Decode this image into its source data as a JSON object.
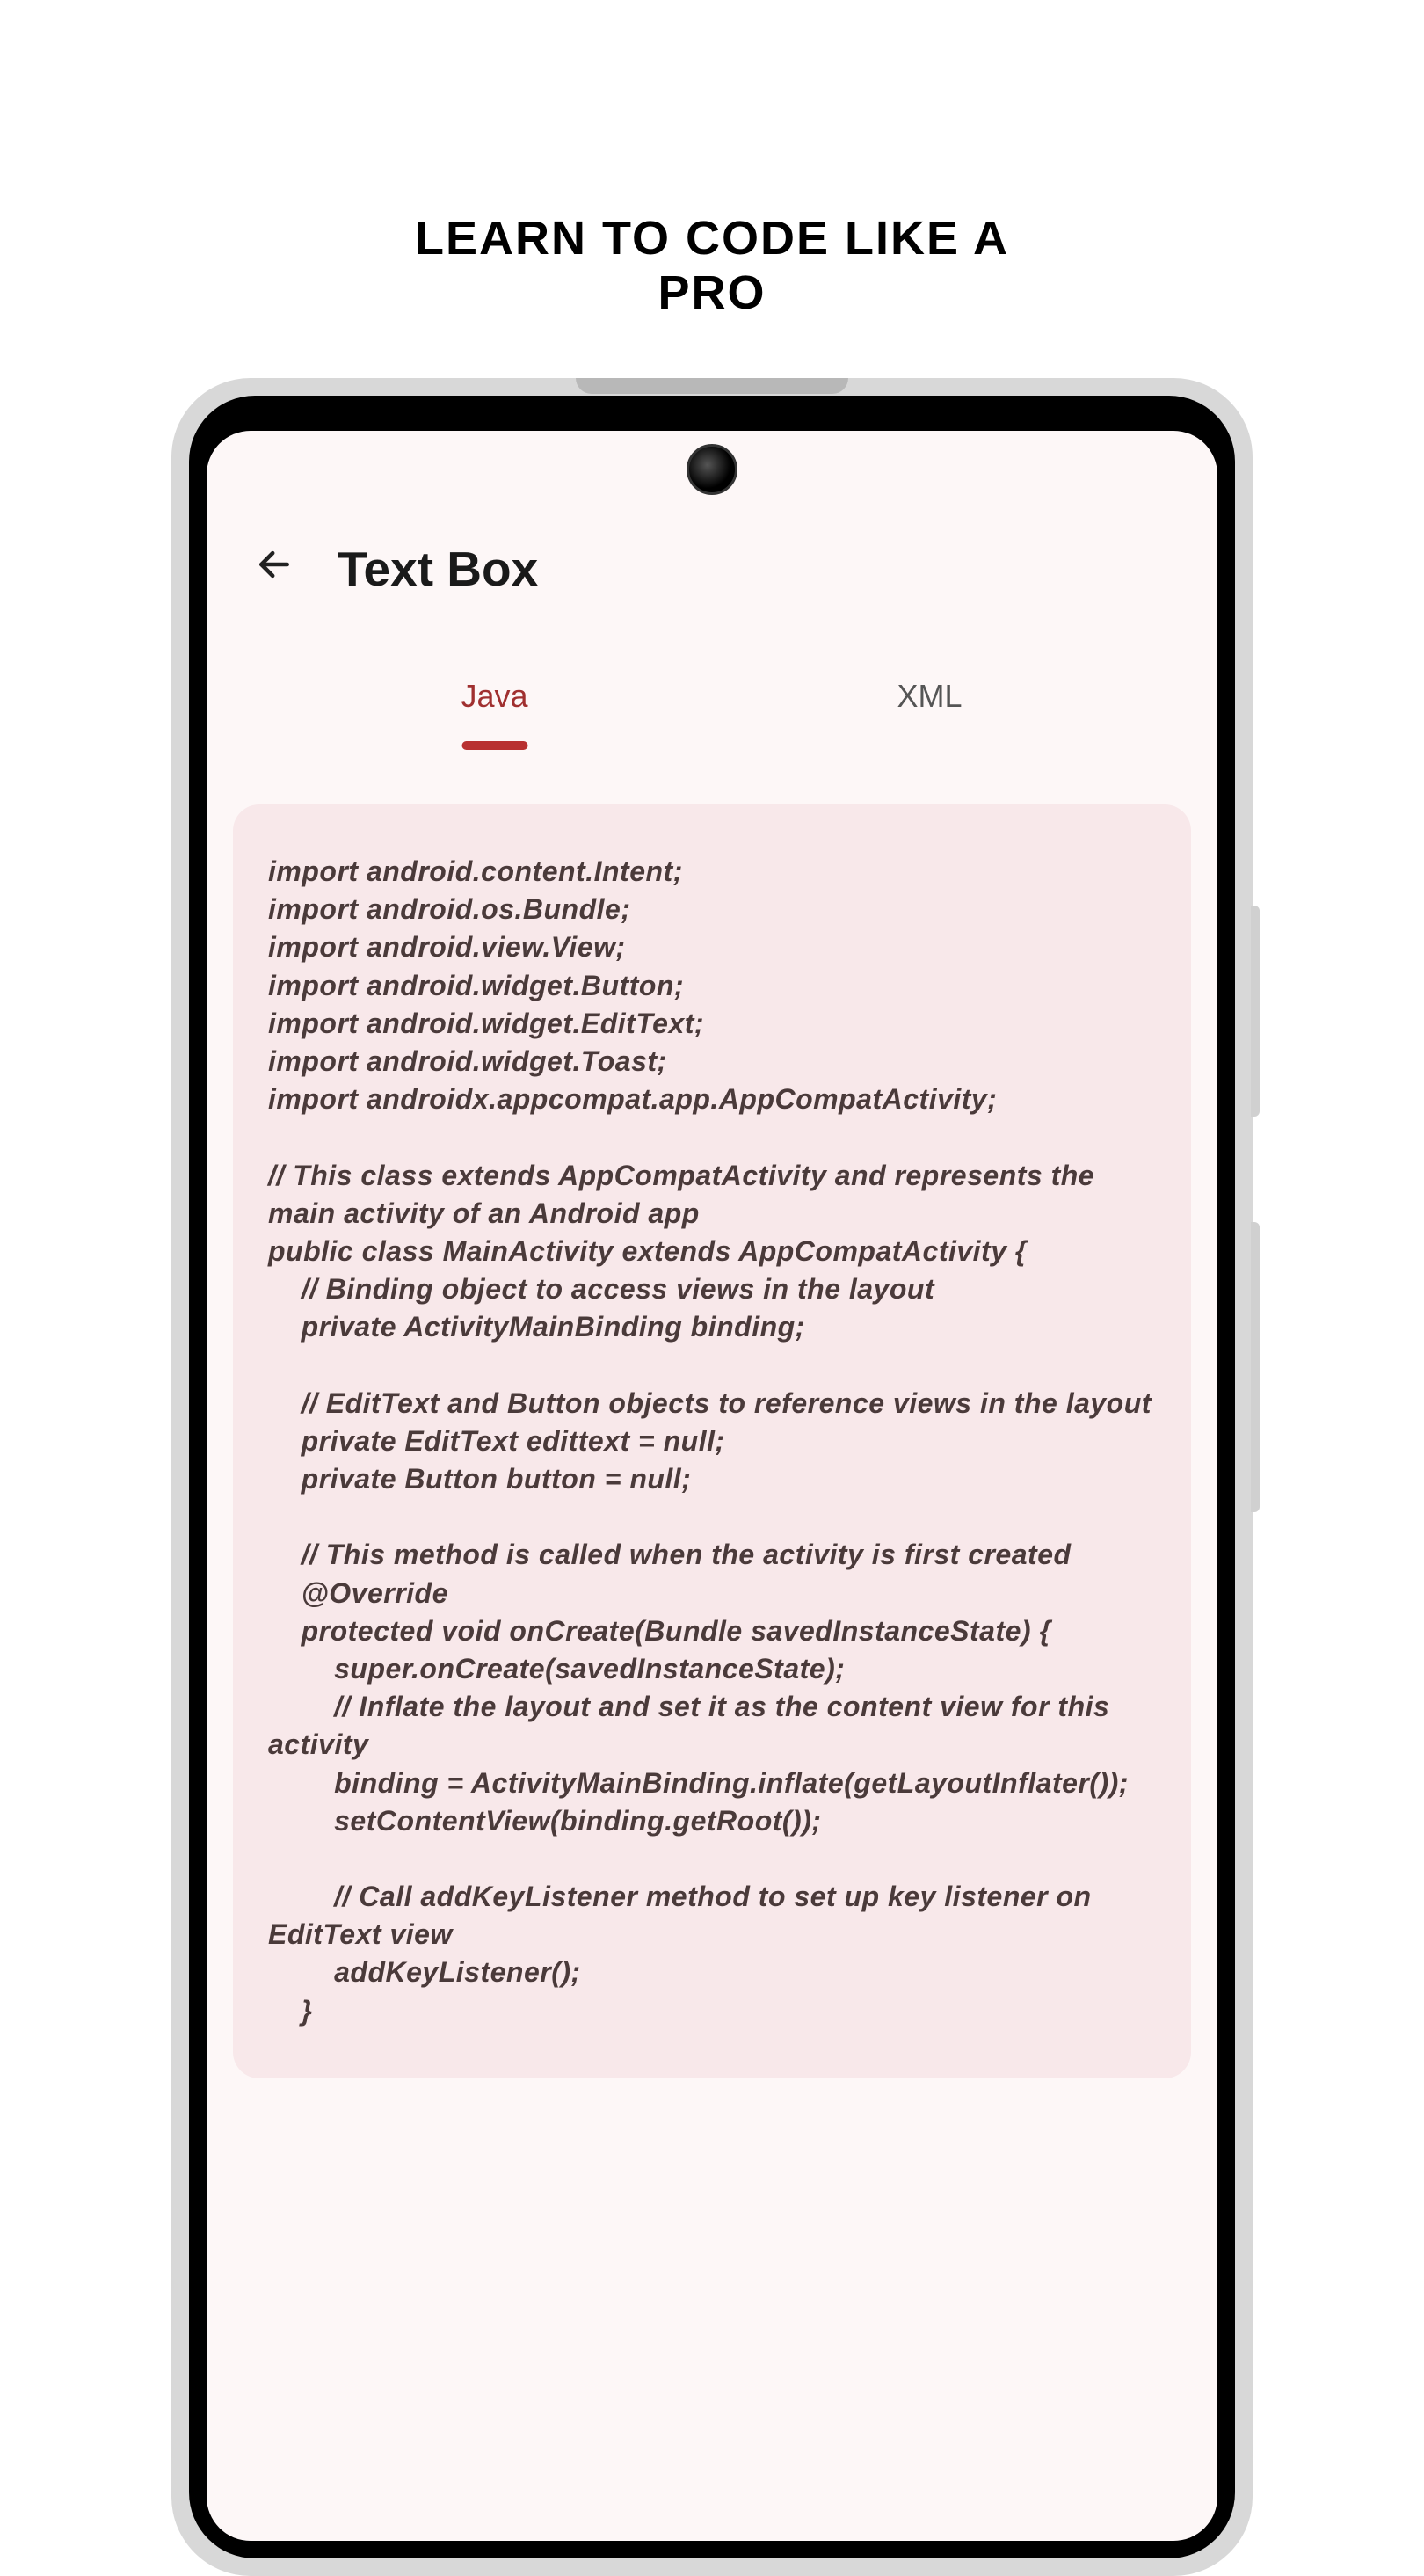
{
  "headline": "LEARN TO CODE LIKE A PRO",
  "header": {
    "title": "Text Box"
  },
  "tabs": {
    "active": "Java",
    "items": [
      {
        "label": "Java",
        "active": true
      },
      {
        "label": "XML",
        "active": false
      }
    ]
  },
  "code": "import android.content.Intent;\nimport android.os.Bundle;\nimport android.view.View;\nimport android.widget.Button;\nimport android.widget.EditText;\nimport android.widget.Toast;\nimport androidx.appcompat.app.AppCompatActivity;\n\n// This class extends AppCompatActivity and represents the main activity of an Android app\npublic class MainActivity extends AppCompatActivity {\n    // Binding object to access views in the layout\n    private ActivityMainBinding binding;\n\n    // EditText and Button objects to reference views in the layout\n    private EditText edittext = null;\n    private Button button = null;\n\n    // This method is called when the activity is first created\n    @Override\n    protected void onCreate(Bundle savedInstanceState) {\n        super.onCreate(savedInstanceState);\n        // Inflate the layout and set it as the content view for this activity\n        binding = ActivityMainBinding.inflate(getLayoutInflater());\n        setContentView(binding.getRoot());\n\n        // Call addKeyListener method to set up key listener on EditText view\n        addKeyListener();\n    }"
}
